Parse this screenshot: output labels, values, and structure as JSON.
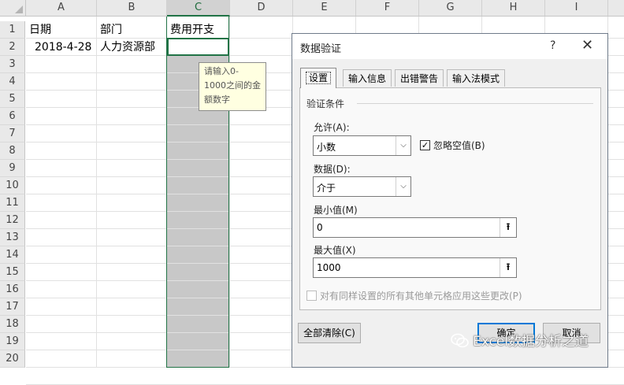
{
  "columns": [
    "A",
    "B",
    "C",
    "D",
    "E",
    "F",
    "G",
    "H",
    "I"
  ],
  "rows": [
    "1",
    "2",
    "3",
    "4",
    "5",
    "6",
    "7",
    "8",
    "9",
    "10",
    "11",
    "12",
    "13",
    "14",
    "15",
    "16",
    "17",
    "18",
    "19",
    "20"
  ],
  "cells": {
    "a1": "日期",
    "b1": "部门",
    "c1": "费用开支",
    "a2": "2018-4-28",
    "b2": "人力资源部"
  },
  "tooltip": {
    "lines": [
      "请输入0-",
      "1000之间的金",
      "额数字"
    ]
  },
  "dialog": {
    "title": "数据验证",
    "help": "?",
    "close": "✕",
    "tabs": [
      "设置",
      "输入信息",
      "出错警告",
      "输入法模式"
    ],
    "section": "验证条件",
    "allow_label": "允许(A):",
    "allow_value": "小数",
    "ignore_blank_label": "忽略空值(B)",
    "ignore_blank_checked": true,
    "data_label": "数据(D):",
    "data_value": "介于",
    "min_label": "最小值(M)",
    "min_value": "0",
    "max_label": "最大值(X)",
    "max_value": "1000",
    "apply_all_label": "对有同样设置的所有其他单元格应用这些更改(P)",
    "clear_all": "全部清除(C)",
    "ok": "确定",
    "cancel": "取消"
  },
  "watermark": "Excel数据分析之道",
  "colors": {
    "accent_green": "#217346",
    "selection_gray": "#c8c8c8",
    "ok_border": "#0078d7"
  }
}
